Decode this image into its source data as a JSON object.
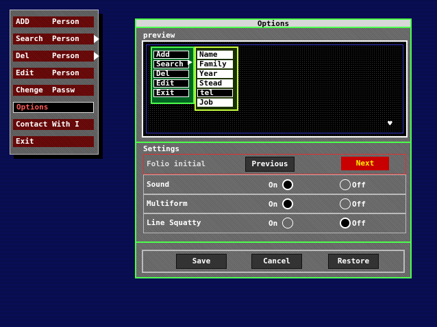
{
  "menu": {
    "items": [
      {
        "label": "ADD     Person"
      },
      {
        "label": "Search  Person"
      },
      {
        "label": "Del     Person"
      },
      {
        "label": "Edit    Person"
      },
      {
        "label": "Chenge  Passw"
      },
      {
        "label": "Options"
      },
      {
        "label": "Contact With I"
      },
      {
        "label": "Exit"
      }
    ]
  },
  "window": {
    "title": "Options",
    "preview_label": "preview",
    "settings_label": "Settings"
  },
  "preview": {
    "col1": [
      "Add",
      "Search",
      "Del",
      "Edit",
      "Exit"
    ],
    "col2": [
      "Name",
      "Family",
      "Year",
      "Stead",
      "tel",
      "Job"
    ],
    "heart": "♥"
  },
  "settings": {
    "folio": {
      "label": "Folio initial",
      "prev": "Previous",
      "next": "Next"
    },
    "sound": {
      "label": "Sound",
      "on": "On",
      "off": "Off"
    },
    "multiform": {
      "label": "Multiform",
      "on": "On",
      "off": "Off"
    },
    "line_squatty": {
      "label": "Line Squatty",
      "on": "On",
      "off": "Off"
    }
  },
  "buttons": {
    "save": "Save",
    "cancel": "Cancel",
    "restore": "Restore"
  }
}
